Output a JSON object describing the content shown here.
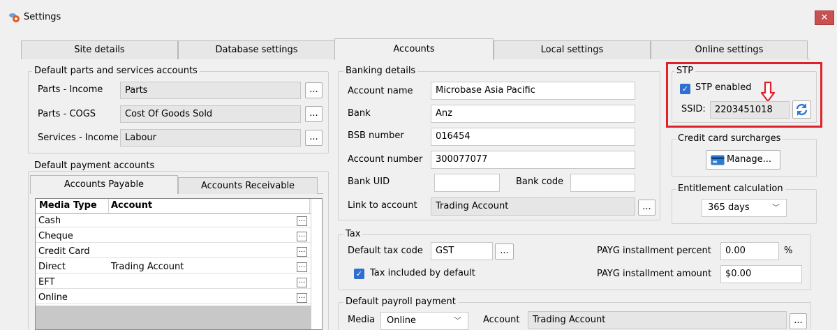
{
  "window": {
    "title": "Settings",
    "close_label": "✕"
  },
  "tabs": [
    "Site details",
    "Database settings",
    "Accounts",
    "Local settings",
    "Online settings"
  ],
  "default_parts": {
    "title": "Default parts and services accounts",
    "rows": [
      {
        "label": "Parts - Income",
        "value": "Parts"
      },
      {
        "label": "Parts - COGS",
        "value": "Cost Of Goods Sold"
      },
      {
        "label": "Services - Income",
        "value": "Labour"
      }
    ],
    "dots": "..."
  },
  "default_payment": {
    "title": "Default payment accounts",
    "subtabs": [
      "Accounts Payable",
      "Accounts Receivable"
    ],
    "columns": [
      "Media Type",
      "Account"
    ],
    "rows": [
      {
        "media": "Cash",
        "account": ""
      },
      {
        "media": "Cheque",
        "account": ""
      },
      {
        "media": "Credit Card",
        "account": ""
      },
      {
        "media": "Direct",
        "account": "Trading Account"
      },
      {
        "media": "EFT",
        "account": ""
      },
      {
        "media": "Online",
        "account": ""
      }
    ],
    "dots": "..."
  },
  "banking": {
    "title": "Banking details",
    "account_name_label": "Account name",
    "account_name": "Microbase Asia Pacific",
    "bank_label": "Bank",
    "bank": "Anz",
    "bsb_label": "BSB number",
    "bsb": "016454",
    "account_number_label": "Account number",
    "account_number": "300077077",
    "bank_uid_label": "Bank UID",
    "bank_uid": "",
    "bank_code_label": "Bank code",
    "bank_code": "",
    "link_label": "Link to account",
    "link": "Trading Account",
    "dots": "..."
  },
  "tax": {
    "title": "Tax",
    "default_code_label": "Default tax code",
    "default_code": "GST",
    "dots": "...",
    "included_label": "Tax included by default",
    "payg_percent_label": "PAYG installment percent",
    "payg_percent": "0.00",
    "percent_sign": "%",
    "payg_amount_label": "PAYG installment amount",
    "payg_amount": "$0.00"
  },
  "payroll": {
    "title": "Default payroll payment",
    "media_label": "Media",
    "media": "Online",
    "account_label": "Account",
    "account": "Trading Account",
    "dots": "..."
  },
  "stp": {
    "title": "STP",
    "enabled_label": "STP enabled",
    "ssid_label": "SSID:",
    "ssid": "2203451018",
    "highlight_color": "#e0212a",
    "arrow_icon": "arrow-down-icon",
    "refresh_icon": "refresh-icon"
  },
  "credit_card": {
    "title": "Credit card surcharges",
    "manage_label": "Manage...",
    "icon": "credit-card-icon"
  },
  "entitlement": {
    "title": "Entitlement calculation",
    "value": "365 days"
  }
}
